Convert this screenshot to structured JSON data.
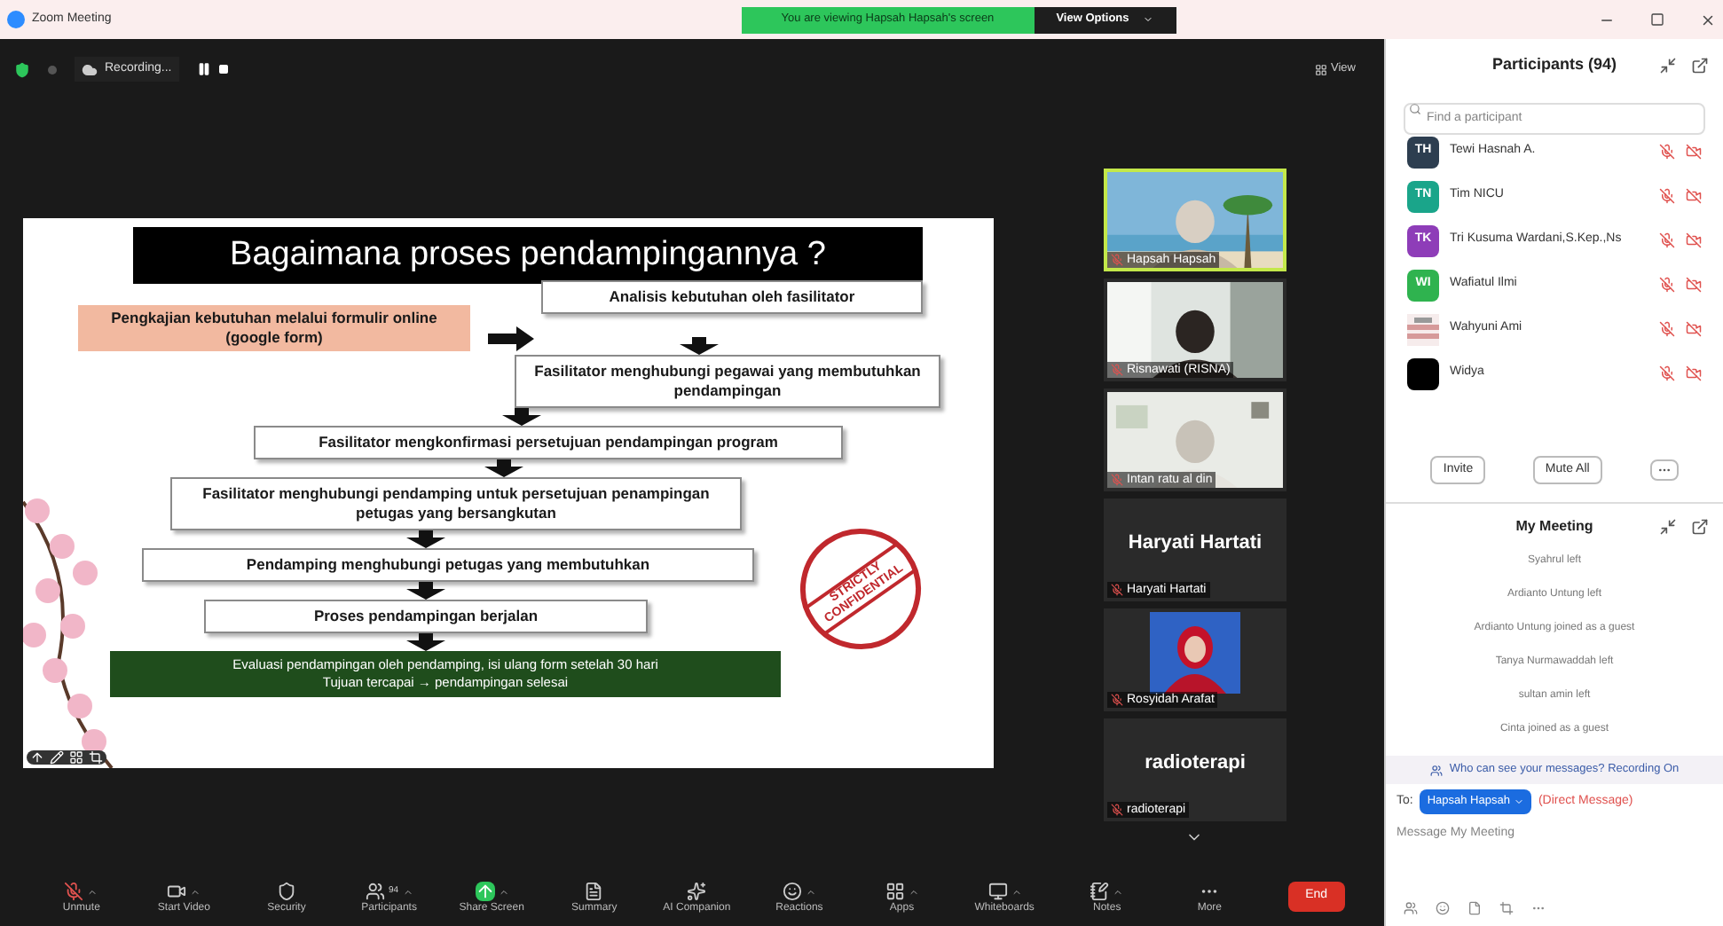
{
  "window": {
    "title": "Zoom Meeting"
  },
  "share_banner": {
    "text": "You are viewing Hapsah Hapsah's screen",
    "button": "View Options"
  },
  "recording": {
    "label": "Recording..."
  },
  "view_button": "View",
  "slide": {
    "title": "Bagaimana proses pendampingannya ?",
    "stamp": "STRICTLY CONFIDENTIAL",
    "steps": [
      {
        "kind": "filled",
        "text": "Pengkajian kebutuhan melalui formulir online (google form)"
      },
      {
        "kind": "box",
        "text": "Analisis kebutuhan oleh fasilitator"
      },
      {
        "kind": "box",
        "text": "Fasilitator menghubungi pegawai yang membutuhkan pendampingan"
      },
      {
        "kind": "box",
        "text": "Fasilitator mengkonfirmasi persetujuan pendampingan program"
      },
      {
        "kind": "box",
        "text": "Fasilitator menghubungi pendamping untuk persetujuan penampingan petugas yang bersangkutan"
      },
      {
        "kind": "box",
        "text": "Pendamping menghubungi petugas yang membutuhkan"
      },
      {
        "kind": "box",
        "text": "Proses pendampingan berjalan"
      },
      {
        "kind": "green",
        "text": "Evaluasi pendampingan oleh pendamping, isi ulang form setelah 30 hari",
        "text2": "Tujuan tercapai → pendampingan selesai"
      }
    ]
  },
  "videos": [
    {
      "kind": "picture",
      "name": "Hapsah Hapsah",
      "speaking": true
    },
    {
      "kind": "picture",
      "name": "Risnawati (RISNA)",
      "speaking": false
    },
    {
      "kind": "picture",
      "name": "Intan ratu al din",
      "speaking": false
    },
    {
      "kind": "name",
      "display": "Haryati Hartati",
      "name": "Haryati Hartati",
      "speaking": false
    },
    {
      "name": "Rosyidah Arafat",
      "speaking": false
    },
    {
      "kind": "name",
      "display": "radioterapi",
      "name": "radioterapi",
      "speaking": false
    }
  ],
  "participants": {
    "title": "Participants (94)",
    "search": {
      "placeholder": "Find a participant"
    },
    "people": [
      {
        "kind": "initials",
        "initials": "TH",
        "name": "Tewi Hasnah A.",
        "color": "#2d3e50"
      },
      {
        "kind": "initials",
        "initials": "TN",
        "name": "Tim NICU",
        "color": "#1aa58a"
      },
      {
        "kind": "initials",
        "initials": "TK",
        "name": "Tri Kusuma Wardani,S.Kep.,Ns",
        "color": "#8e3db8"
      },
      {
        "kind": "initials",
        "initials": "WI",
        "name": "Wafiatul Ilmi",
        "color": "#2fb34f"
      },
      {
        "kind": "picture",
        "name": "Wahyuni Ami"
      },
      {
        "kind": "blank",
        "name": "Widya",
        "color": "#000000"
      }
    ],
    "buttons": [
      "Invite",
      "Mute All"
    ]
  },
  "chat": {
    "title": "My Meeting",
    "messages": [
      "Syahrul left",
      "Ardianto Untung left",
      "Ardianto Untung joined as a guest",
      "Tanya Nurmawaddah left",
      "sultan amin left",
      "Cinta joined as a guest"
    ],
    "notice": "Who can see your messages? Recording On",
    "to_label": "To:",
    "recipient": "Hapsah Hapsah",
    "recipient_note": "(Direct Message)",
    "input": {
      "placeholder": "Message My Meeting"
    }
  },
  "toolbar": [
    {
      "kind": "mic",
      "label": "Unmute",
      "caret": true
    },
    {
      "kind": "video",
      "label": "Start Video",
      "caret": true
    },
    {
      "kind": "security",
      "label": "Security",
      "caret": false
    },
    {
      "kind": "participants",
      "label": "Participants",
      "count": "94",
      "caret": true
    },
    {
      "kind": "share",
      "label": "Share Screen",
      "caret": true
    },
    {
      "kind": "summary",
      "label": "Summary",
      "caret": false
    },
    {
      "kind": "ai",
      "label": "AI Companion",
      "caret": false
    },
    {
      "kind": "reactions",
      "label": "Reactions",
      "caret": true
    },
    {
      "kind": "apps",
      "label": "Apps",
      "caret": true
    },
    {
      "kind": "whiteboard",
      "label": "Whiteboards",
      "caret": true
    },
    {
      "kind": "notes",
      "label": "Notes",
      "caret": true
    },
    {
      "kind": "more",
      "label": "More",
      "caret": false
    }
  ],
  "end_button": "End"
}
